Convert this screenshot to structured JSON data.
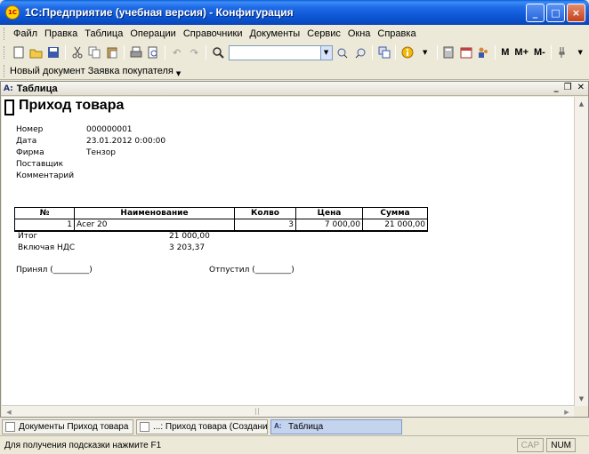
{
  "window": {
    "title": "1С:Предприятие (учебная версия) - Конфигурация",
    "minimize": "_",
    "maximize": "□",
    "close": "×"
  },
  "menu": [
    "Файл",
    "Правка",
    "Таблица",
    "Операции",
    "Справочники",
    "Документы",
    "Сервис",
    "Окна",
    "Справка"
  ],
  "toolbar": {
    "search_value": "",
    "m_label": "М",
    "m_plus_label": "М+",
    "m_minus_label": "М-"
  },
  "doc_toolbar": {
    "label": "Новый документ Заявка покупателя"
  },
  "child_window": {
    "title": "Таблица"
  },
  "document": {
    "title": "Приход товара",
    "fields": [
      {
        "label": "Номер",
        "value": "000000001"
      },
      {
        "label": "Дата",
        "value": "23.01.2012 0:00:00"
      },
      {
        "label": "Фирма",
        "value": "Тензор"
      },
      {
        "label": "Поставщик",
        "value": ""
      },
      {
        "label": "Комментарий",
        "value": ""
      }
    ],
    "table": {
      "headers": [
        "№",
        "Наименование",
        "Колво",
        "Цена",
        "Сумма"
      ],
      "rows": [
        [
          "1",
          "Acer 20",
          "3",
          "7 000,00",
          "21 000,00"
        ]
      ]
    },
    "total_label": "Итог",
    "total_value": "21 000,00",
    "vat_label": "Включая НДС",
    "vat_value": "3 203,37",
    "accepted_label": "Принял (_________)",
    "released_label": "Отпустил (_________)"
  },
  "window_tabs": [
    "Документы Приход товара",
    "...: Приход товара (Создани...",
    "Таблица"
  ],
  "status": {
    "hint": "Для получения подсказки нажмите F1",
    "cap": "CAP",
    "num": "NUM"
  }
}
